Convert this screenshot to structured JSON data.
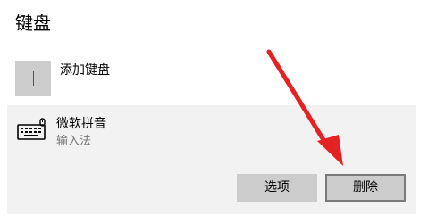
{
  "section": {
    "title": "键盘"
  },
  "add_keyboard": {
    "label": "添加键盘",
    "icon": "plus-icon"
  },
  "keyboard_item": {
    "name": "微软拼音",
    "type": "输入法",
    "icon": "keyboard-icon",
    "options_label": "选项",
    "delete_label": "删除"
  },
  "colors": {
    "tile_gray": "#cccccc",
    "item_background": "#f2f2f2",
    "annotation_arrow": "#e52222",
    "secondary_text": "#767676"
  }
}
